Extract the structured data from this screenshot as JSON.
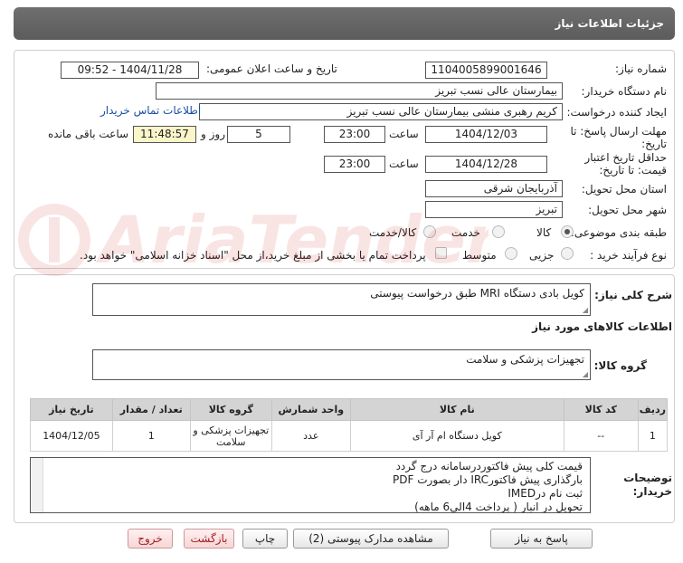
{
  "header": {
    "title": "جزئیات اطلاعات نیاز"
  },
  "form": {
    "need_number_label": "شماره نیاز:",
    "need_number": "1104005899001646",
    "announce_label": "تاریخ و ساعت اعلان عمومی:",
    "announce_value": "1404/11/28 - 09:52",
    "buyer_label": "نام دستگاه خریدار:",
    "buyer_value": "بیمارستان عالی نسب تبریز",
    "creator_label": "ایجاد کننده درخواست:",
    "creator_value": "کریم رهبری منشی بیمارستان عالی نسب تبریز",
    "contact_link": "اطلاعات تماس خریدار",
    "deadline_label_1": "مهلت ارسال پاسخ: تا",
    "deadline_label_2": "تاریخ:",
    "deadline_date": "1404/12/03",
    "time_label": "ساعت",
    "deadline_time": "23:00",
    "days_value": "5",
    "days_label": "روز و",
    "remaining_time": "11:48:57",
    "remaining_label": "ساعت باقی مانده",
    "validity_label_1": "حداقل تاریخ اعتبار",
    "validity_label_2": "قیمت: تا تاریخ:",
    "validity_date": "1404/12/28",
    "validity_time": "23:00",
    "province_label": "استان محل تحویل:",
    "province_value": "آذربایجان شرقی",
    "city_label": "شهر محل تحویل:",
    "city_value": "تبریز",
    "category_label": "طبقه بندی موضوعی:",
    "category_options": [
      "کالا",
      "خدمت",
      "کالا/خدمت"
    ],
    "category_selected": "کالا",
    "process_label": "نوع فرآیند خرید :",
    "process_options": [
      "جزیی",
      "متوسط"
    ],
    "payment_note": "پرداخت تمام یا بخشی از مبلغ خرید،از محل \"اسناد خزانه اسلامی\" خواهد بود."
  },
  "details": {
    "summary_label": "شرح کلی نیاز:",
    "summary_value": "کویل بادی دستگاه MRI طبق درخواست پیوستی",
    "goods_info_label": "اطلاعات کالاهای مورد نیاز",
    "goods_group_label": "گروه کالا:",
    "goods_group_value": "تجهیزات پزشکی و سلامت",
    "table": {
      "headers": [
        "ردیف",
        "کد کالا",
        "نام کالا",
        "واحد شمارش",
        "گروه کالا",
        "تعداد / مقدار",
        "تاریخ نیاز"
      ],
      "rows": [
        [
          "1",
          "--",
          "کویل دستگاه ام آر آی",
          "عدد",
          "تجهیزات پزشکی و سلامت",
          "1",
          "1404/12/05"
        ]
      ]
    },
    "notes_label_1": "توضیحات",
    "notes_label_2": "خریدار:",
    "notes_lines": [
      "قیمت کلی پیش فاکتوردرسامانه درج گردد",
      "بارگذاری پیش فاکتورIRC دار بصورت PDF",
      "ثبت نام درIMED",
      "تحویل در انبار ( پرداخت 4الی6 ماهه)"
    ]
  },
  "buttons": {
    "reply": "پاسخ به نیاز",
    "view_docs": "مشاهده مدارک پیوستی (2)",
    "print": "چاپ",
    "back": "بازگشت",
    "exit": "خروج"
  },
  "colors": {
    "header_bg": "#626262",
    "link": "#1a4fa3",
    "remaining_bg": "#fbf6c9",
    "table_header_bg": "#d4d4d4"
  }
}
